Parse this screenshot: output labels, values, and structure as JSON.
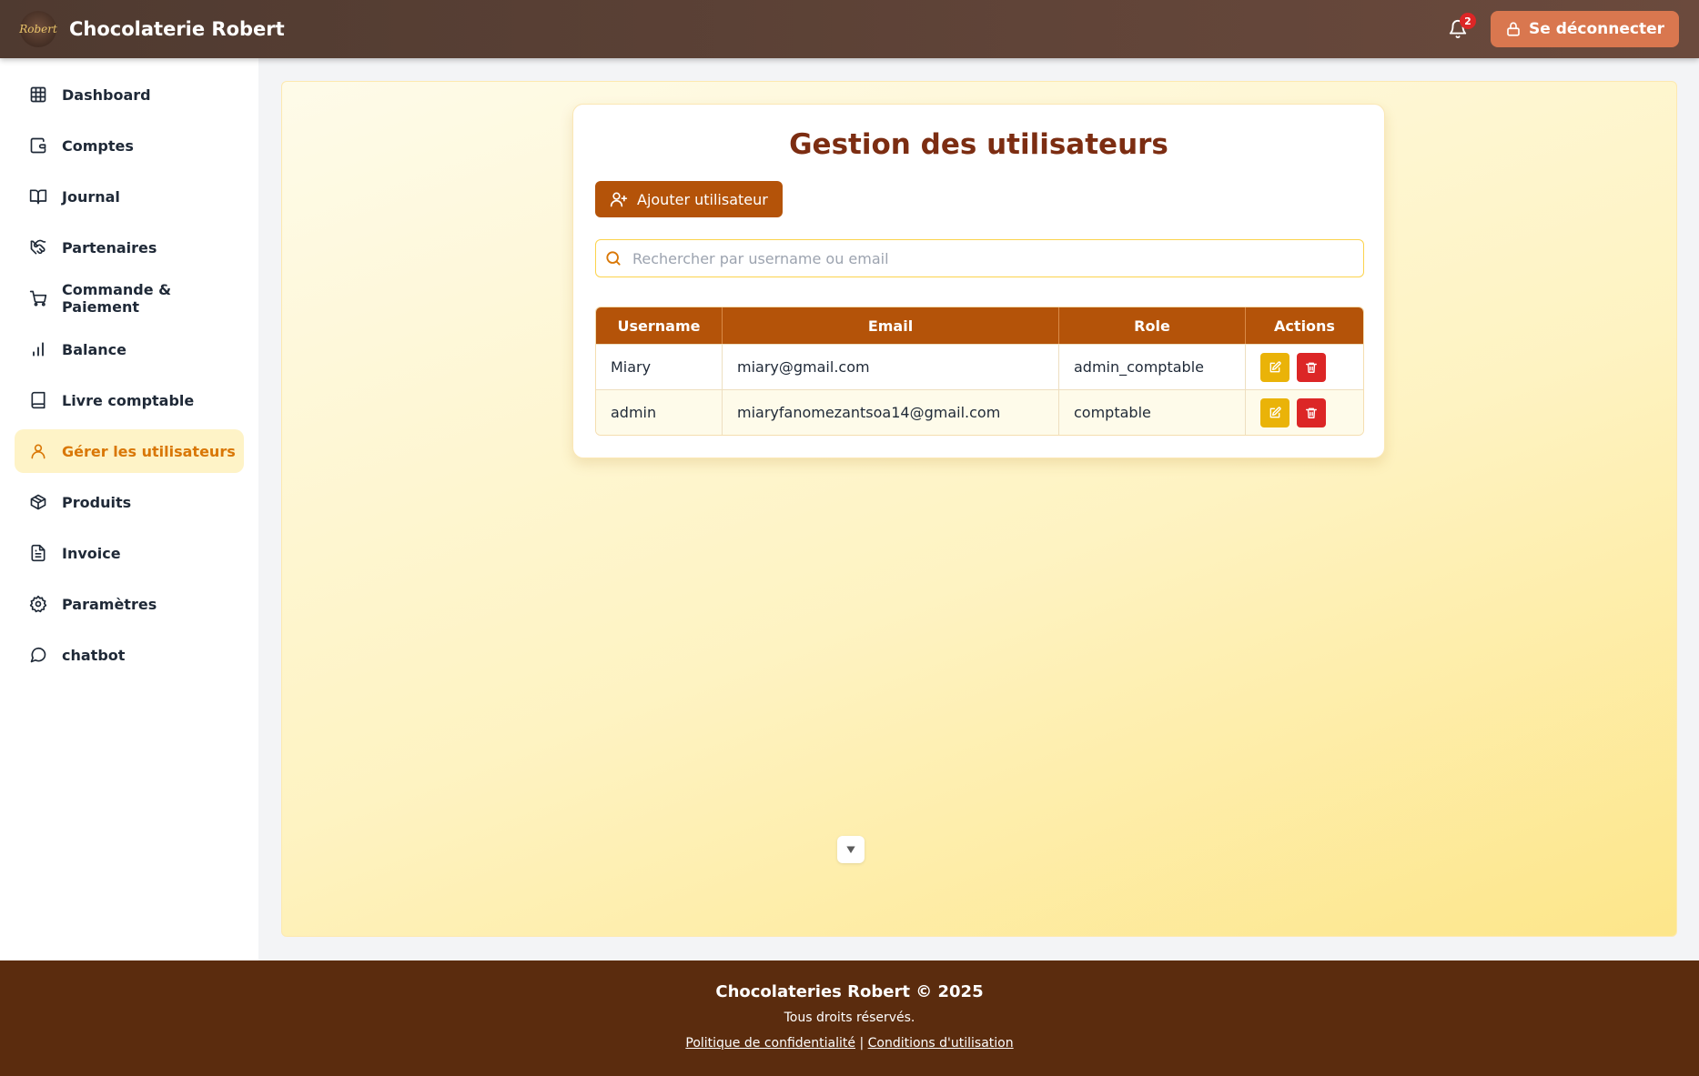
{
  "header": {
    "logo_text": "Robert",
    "title": "Chocolaterie Robert",
    "notification_count": "2",
    "logout_label": "Se déconnecter"
  },
  "sidebar": {
    "items": [
      {
        "label": "Dashboard",
        "icon": "grid-icon"
      },
      {
        "label": "Comptes",
        "icon": "wallet-icon"
      },
      {
        "label": "Journal",
        "icon": "book-open-icon"
      },
      {
        "label": "Partenaires",
        "icon": "handshake-icon"
      },
      {
        "label": "Commande & Paiement",
        "icon": "cart-icon"
      },
      {
        "label": "Balance",
        "icon": "bar-chart-icon"
      },
      {
        "label": "Livre comptable",
        "icon": "book-icon"
      },
      {
        "label": "Gérer les utilisateurs",
        "icon": "user-icon",
        "active": true
      },
      {
        "label": "Produits",
        "icon": "package-icon"
      },
      {
        "label": "Invoice",
        "icon": "file-text-icon"
      },
      {
        "label": "Paramètres",
        "icon": "gear-icon"
      },
      {
        "label": "chatbot",
        "icon": "message-circle-icon"
      }
    ]
  },
  "main": {
    "title": "Gestion des utilisateurs",
    "add_user_label": "Ajouter utilisateur",
    "search_placeholder": "Rechercher par username ou email",
    "table": {
      "columns": [
        "Username",
        "Email",
        "Role",
        "Actions"
      ],
      "rows": [
        {
          "username": "Miary",
          "email": "miary@gmail.com",
          "role": "admin_comptable"
        },
        {
          "username": "admin",
          "email": "miaryfanomezantsoa14@gmail.com",
          "role": "comptable"
        }
      ]
    }
  },
  "footer": {
    "title": "Chocolateries Robert © 2025",
    "rights": "Tous droits réservés.",
    "privacy_link": "Politique de confidentialité",
    "separator": "|",
    "terms_link": "Conditions d'utilisation"
  },
  "colors": {
    "header_bg": "#5a4035",
    "accent_brown": "#b45309",
    "title_brown": "#7c2d12",
    "active_nav_bg": "#fef3c7",
    "active_nav_text": "#d97706",
    "edit_yellow": "#eab308",
    "delete_red": "#dc2626",
    "footer_bg": "#5b2c0e"
  }
}
